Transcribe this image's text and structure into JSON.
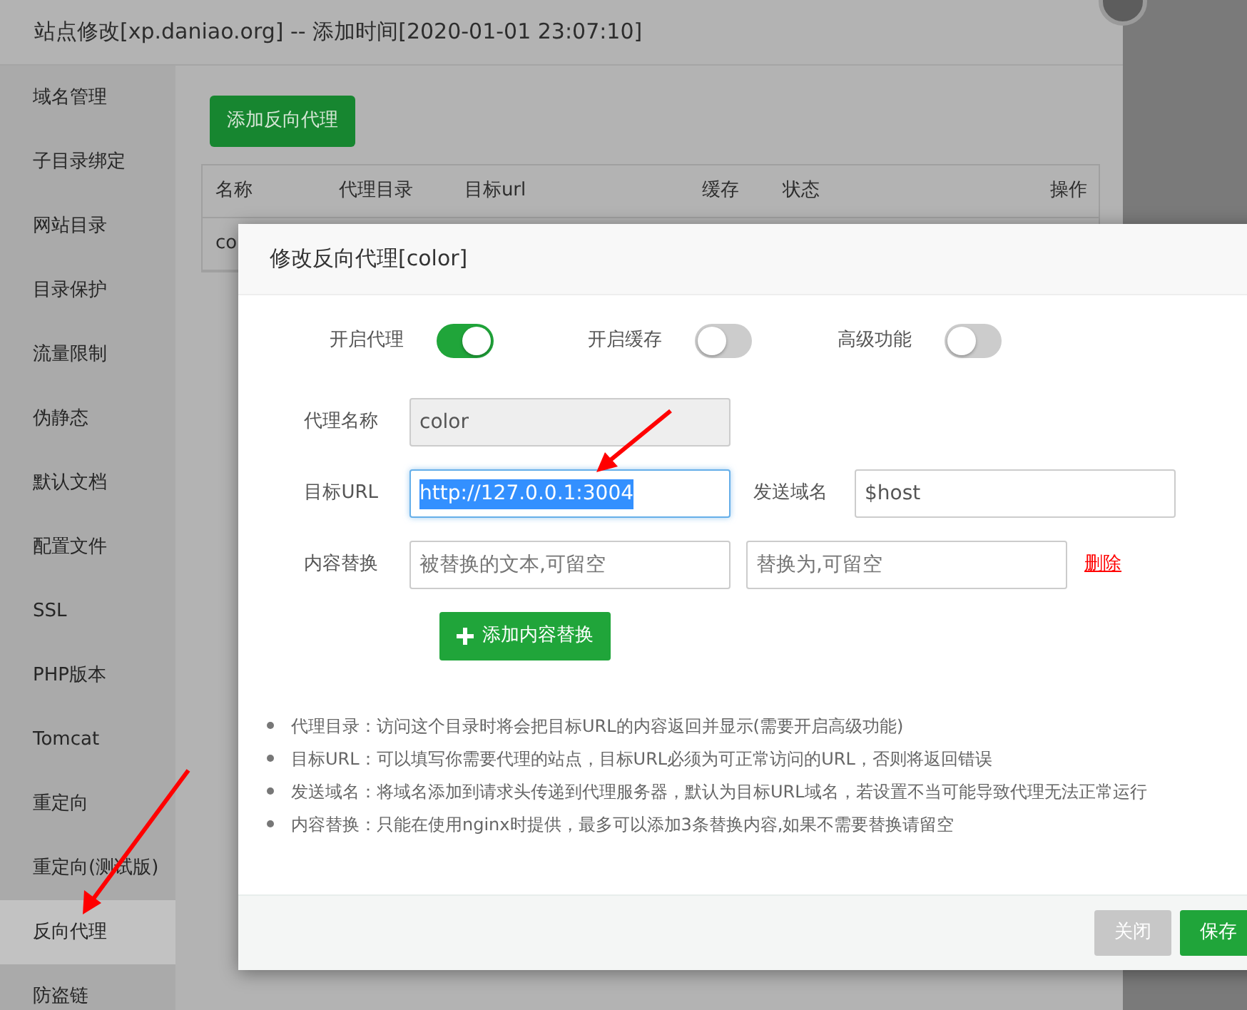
{
  "window": {
    "title": "站点修改[xp.daniao.org] -- 添加时间[2020-01-01 23:07:10]"
  },
  "sidebar": {
    "items": [
      {
        "label": "域名管理",
        "selected": false
      },
      {
        "label": "子目录绑定",
        "selected": false
      },
      {
        "label": "网站目录",
        "selected": false
      },
      {
        "label": "目录保护",
        "selected": false
      },
      {
        "label": "流量限制",
        "selected": false
      },
      {
        "label": "伪静态",
        "selected": false
      },
      {
        "label": "默认文档",
        "selected": false
      },
      {
        "label": "配置文件",
        "selected": false
      },
      {
        "label": "SSL",
        "selected": false
      },
      {
        "label": "PHP版本",
        "selected": false
      },
      {
        "label": "Tomcat",
        "selected": false
      },
      {
        "label": "重定向",
        "selected": false
      },
      {
        "label": "重定向(测试版)",
        "selected": false
      },
      {
        "label": "反向代理",
        "selected": true
      },
      {
        "label": "防盗链",
        "selected": false
      }
    ]
  },
  "add_button": "添加反向代理",
  "table": {
    "columns": [
      "名称",
      "代理目录",
      "目标url",
      "缓存",
      "状态",
      "操作"
    ],
    "rows": [
      [
        "co"
      ]
    ]
  },
  "modal": {
    "title": "修改反向代理[color]",
    "switches": [
      {
        "label": "开启代理",
        "on": true
      },
      {
        "label": "开启缓存",
        "on": false
      },
      {
        "label": "高级功能",
        "on": false
      }
    ],
    "name_field": {
      "label": "代理名称",
      "value": "color",
      "disabled": true
    },
    "url_field": {
      "label": "目标URL",
      "value": "http://127.0.0.1:3004",
      "selected": true
    },
    "host_field": {
      "label": "发送域名",
      "value": "$host"
    },
    "replace": {
      "label": "内容替换",
      "from_placeholder": "被替换的文本,可留空",
      "to_placeholder": "替换为,可留空",
      "delete": "删除"
    },
    "add_replace_button": "添加内容替换",
    "notes": [
      "代理目录：访问这个目录时将会把目标URL的内容返回并显示(需要开启高级功能)",
      "目标URL：可以填写你需要代理的站点，目标URL必须为可正常访问的URL，否则将返回错误",
      "发送域名：将域名添加到请求头传递到代理服务器，默认为目标URL域名，若设置不当可能导致代理无法正常运行",
      "内容替换：只能在使用nginx时提供，最多可以添加3条替换内容,如果不需要替换请留空"
    ],
    "buttons": [
      {
        "label": "关闭",
        "kind": "secondary"
      },
      {
        "label": "保存",
        "kind": "primary"
      }
    ]
  }
}
